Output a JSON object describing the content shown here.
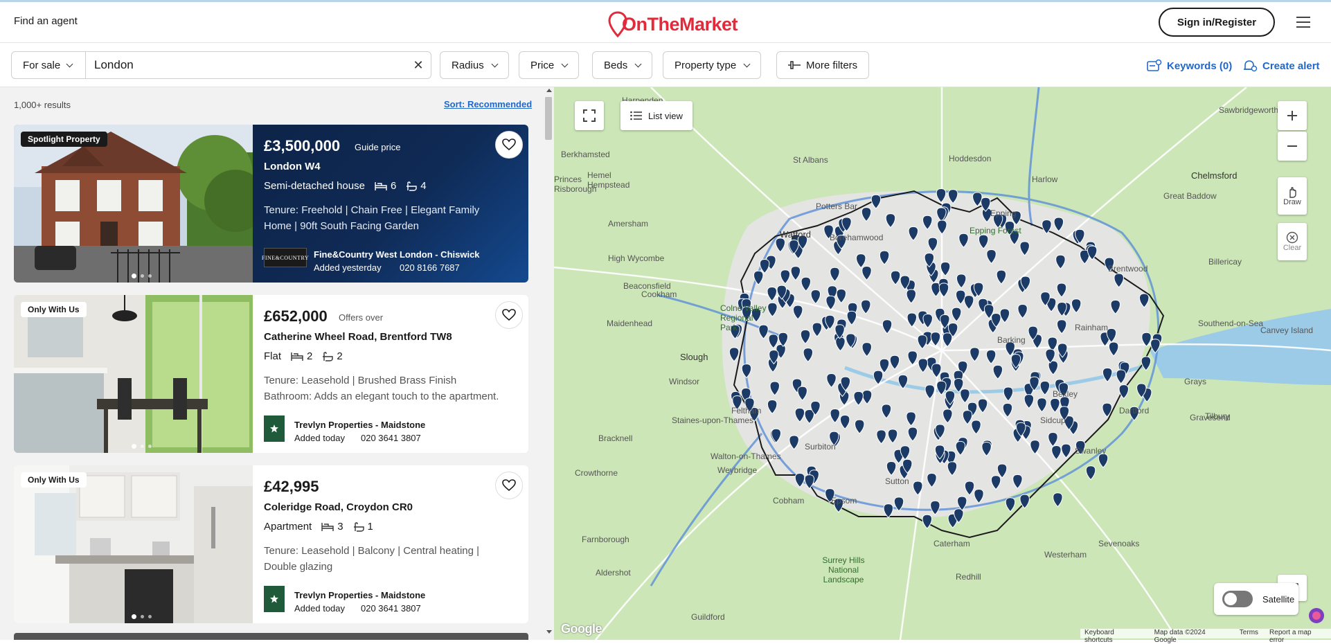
{
  "header": {
    "find_agent": "Find an agent",
    "logo_text": "OnTheMarket",
    "signin_label": "Sign in/Register"
  },
  "search": {
    "listing_type": "For sale",
    "location_value": "London",
    "filters": [
      "Radius",
      "Price",
      "Beds",
      "Property type"
    ],
    "more_filters": "More filters",
    "keywords": "Keywords (0)",
    "create_alert": "Create alert"
  },
  "results": {
    "count": "1,000+ results",
    "sort_label": "Sort: Recommended"
  },
  "listings": [
    {
      "badge": "Spotlight Property",
      "price": "£3,500,000",
      "price_qualifier": "Guide price",
      "address": "London W4",
      "type": "Semi-detached house",
      "beds": "6",
      "baths": "4",
      "description": "Tenure: Freehold | Chain Free | Elegant Family Home | 90ft South Facing Garden",
      "agent": "Fine&Country West London - Chiswick",
      "added": "Added yesterday",
      "phone": "020 8166 7687",
      "agent_logo_text": "FINE&COUNTRY"
    },
    {
      "badge": "Only With Us",
      "price": "£652,000",
      "price_qualifier": "Offers over",
      "address": "Catherine Wheel Road, Brentford TW8",
      "type": "Flat",
      "beds": "2",
      "baths": "2",
      "description": "Tenure: Leasehold | Brushed Brass Finish Bathroom: Adds an elegant touch to the apartment. |Parking...",
      "agent": "Trevlyn Properties - Maidstone",
      "added": "Added today",
      "phone": "020 3641 3807"
    },
    {
      "badge": "Only With Us",
      "price": "£42,995",
      "price_qualifier": "",
      "address": "Coleridge Road, Croydon CR0",
      "type": "Apartment",
      "beds": "3",
      "baths": "1",
      "description": "Tenure: Leasehold | Balcony | Central heating | Double glazing",
      "agent": "Trevlyn Properties - Maidstone",
      "added": "Added today",
      "phone": "020 3641 3807"
    }
  ],
  "map": {
    "list_view": "List view",
    "draw": "Draw",
    "clear": "Clear",
    "satellite": "Satellite",
    "google": "Google",
    "footer": [
      "Keyboard shortcuts",
      "Map data ©2024 Google",
      "Terms",
      "Report a map error"
    ],
    "places": [
      {
        "name": "Harpenden"
      },
      {
        "name": "Sawbridgeworth"
      },
      {
        "name": "Berkhamsted"
      },
      {
        "name": "Hemel Hempstead"
      },
      {
        "name": "St Albans"
      },
      {
        "name": "Hoddesdon"
      },
      {
        "name": "Harlow"
      },
      {
        "name": "Chelmsford"
      },
      {
        "name": "Great Baddow"
      },
      {
        "name": "Princes Risborough"
      },
      {
        "name": "Amersham"
      },
      {
        "name": "Potters Bar"
      },
      {
        "name": "Epping"
      },
      {
        "name": "Watford"
      },
      {
        "name": "Borehamwood"
      },
      {
        "name": "Epping Forest"
      },
      {
        "name": "High Wycombe"
      },
      {
        "name": "Beaconsfield"
      },
      {
        "name": "Brentwood"
      },
      {
        "name": "Billericay"
      },
      {
        "name": "Colne Valley Regional Park"
      },
      {
        "name": "Cookham"
      },
      {
        "name": "Maidenhead"
      },
      {
        "name": "Slough"
      },
      {
        "name": "Windsor"
      },
      {
        "name": "Rainham"
      },
      {
        "name": "Southend-on-Sea"
      },
      {
        "name": "Canvey Island"
      },
      {
        "name": "Grays"
      },
      {
        "name": "Tilbury"
      },
      {
        "name": "Dartford"
      },
      {
        "name": "Bracknell"
      },
      {
        "name": "Staines-upon-Thames"
      },
      {
        "name": "Feltham"
      },
      {
        "name": "Gravesend"
      },
      {
        "name": "Walton-on-Thames"
      },
      {
        "name": "Weybridge"
      },
      {
        "name": "Crowthorne"
      },
      {
        "name": "Surbiton"
      },
      {
        "name": "Sutton"
      },
      {
        "name": "Cobham"
      },
      {
        "name": "Epsom"
      },
      {
        "name": "Sidcup"
      },
      {
        "name": "Swanley"
      },
      {
        "name": "Farnborough"
      },
      {
        "name": "Caterham"
      },
      {
        "name": "Aldershot"
      },
      {
        "name": "Westerham"
      },
      {
        "name": "Sevenoaks"
      },
      {
        "name": "Guildford"
      },
      {
        "name": "Surrey Hills National Landscape"
      },
      {
        "name": "Redhill"
      },
      {
        "name": "Bexley"
      },
      {
        "name": "Barking"
      }
    ]
  },
  "colors": {
    "brand_red": "#e22a3b",
    "link_blue": "#2068c9",
    "pin_navy": "#1c3a66",
    "spotlight_navy": "#0f2a55"
  }
}
